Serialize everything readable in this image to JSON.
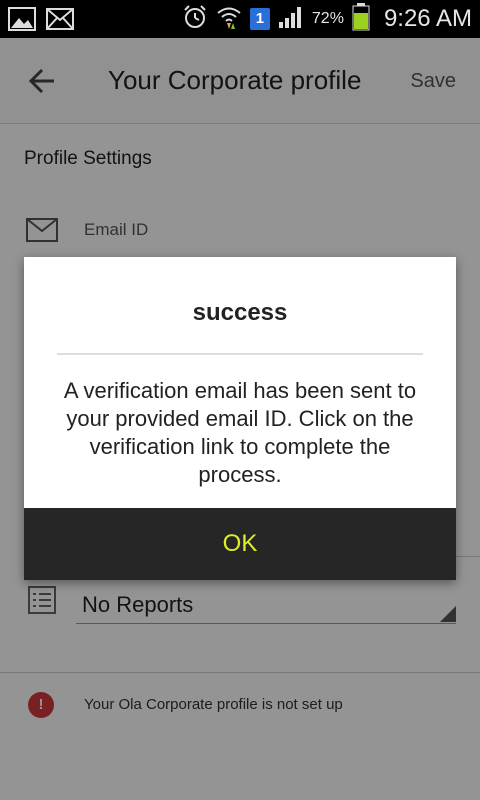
{
  "status_bar": {
    "battery_percent": "72%",
    "time": "9:26 AM",
    "sim_slot": "1",
    "icons": [
      "gallery-icon",
      "mail-icon",
      "alarm-icon",
      "wifi-icon",
      "sim-icon",
      "signal-icon",
      "battery-icon"
    ],
    "battery_level": 0.72,
    "battery_color": "#9bd21f"
  },
  "header": {
    "title": "Your Corporate profile",
    "save_label": "Save"
  },
  "profile": {
    "section_title": "Profile Settings",
    "email_label": "Email ID",
    "reports_value": "No Reports",
    "alert_text": "Your Ola Corporate profile is not set up"
  },
  "dialog": {
    "title": "success",
    "message": "A verification email has been sent to your provided email ID. Click on the verification link to complete the process.",
    "ok_label": "OK",
    "ok_color": "#e0ee2a"
  }
}
